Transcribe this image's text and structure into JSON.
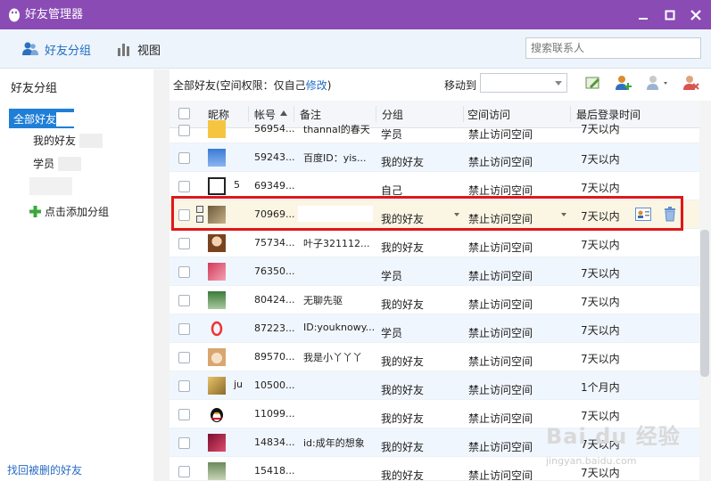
{
  "window": {
    "title": "好友管理器"
  },
  "toolbar": {
    "friend_groups_label": "好友分组",
    "view_label": "视图",
    "search_placeholder": "搜索联系人"
  },
  "sidebar": {
    "title": "好友分组",
    "groups": [
      {
        "label": "全部好友",
        "active": true
      },
      {
        "label": "我的好友",
        "active": false
      },
      {
        "label": "学员",
        "active": false
      }
    ],
    "add_group_label": "点击添加分组",
    "recover_label": "找回被删的好友"
  },
  "content": {
    "all_friends_text": "全部好友(空间权限：仅自己",
    "modify_link": "修改",
    "close_paren": ")",
    "move_to_label": "移动到"
  },
  "table": {
    "columns": {
      "nick": "昵称",
      "account": "帐号",
      "note": "备注",
      "group": "分组",
      "space": "空间访问",
      "last_login": "最后登录时间"
    },
    "rows": [
      {
        "nick": "",
        "account": "56954...",
        "note": "thannal的春天",
        "group": "学员",
        "space": "禁止访问空间",
        "last_login": "7天以内"
      },
      {
        "nick": "",
        "account": "59243...",
        "note": "百度ID：yis...",
        "group": "我的好友",
        "space": "禁止访问空间",
        "last_login": "7天以内"
      },
      {
        "nick": "5",
        "account": "69349...",
        "note": "",
        "group": "自己",
        "space": "禁止访问空间",
        "last_login": "7天以内"
      },
      {
        "nick": "",
        "account": "70969...",
        "note": "",
        "group": "我的好友",
        "space": "禁止访问空间",
        "last_login": "7天以内"
      },
      {
        "nick": "",
        "account": "75734...",
        "note": "叶子321112...",
        "group": "我的好友",
        "space": "禁止访问空间",
        "last_login": "7天以内"
      },
      {
        "nick": "",
        "account": "76350...",
        "note": "",
        "group": "学员",
        "space": "禁止访问空间",
        "last_login": "7天以内"
      },
      {
        "nick": "",
        "account": "80424...",
        "note": "无聊先驱",
        "group": "我的好友",
        "space": "禁止访问空间",
        "last_login": "7天以内"
      },
      {
        "nick": "",
        "account": "87223...",
        "note": "ID:youknowy...",
        "group": "学员",
        "space": "禁止访问空间",
        "last_login": "7天以内"
      },
      {
        "nick": "",
        "account": "89570...",
        "note": "我是小丫丫丫",
        "group": "我的好友",
        "space": "禁止访问空间",
        "last_login": "7天以内"
      },
      {
        "nick": "ju",
        "account": "10500...",
        "note": "",
        "group": "我的好友",
        "space": "禁止访问空间",
        "last_login": "1个月内"
      },
      {
        "nick": "",
        "account": "11099...",
        "note": "",
        "group": "我的好友",
        "space": "禁止访问空间",
        "last_login": "7天以内"
      },
      {
        "nick": "",
        "account": "14834...",
        "note": "id:成年的想象",
        "group": "我的好友",
        "space": "禁止访问空间",
        "last_login": "7天以内"
      },
      {
        "nick": "",
        "account": "15418...",
        "note": "",
        "group": "我的好友",
        "space": "禁止访问空间",
        "last_login": "7天以内"
      }
    ]
  },
  "watermark": {
    "text": "Bai du 经验",
    "url": "jingyan.baidu.com"
  },
  "colors": {
    "titlebar": "#8a4bb5",
    "accent": "#1f7fd6",
    "highlight": "#e0171b"
  }
}
